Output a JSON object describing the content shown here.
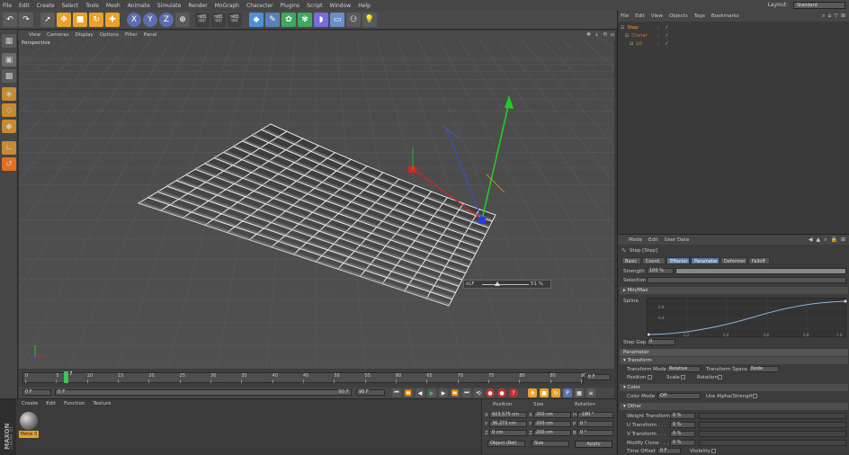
{
  "menu": [
    "File",
    "Edit",
    "Create",
    "Select",
    "Tools",
    "Mesh",
    "Animate",
    "Simulate",
    "Render",
    "MoGraph",
    "Character",
    "Plugins",
    "Script",
    "Window",
    "Help"
  ],
  "layout": {
    "label": "Layout:",
    "value": "Standard"
  },
  "toolbar": {
    "x": "X",
    "y": "Y",
    "z": "Z"
  },
  "viewport": {
    "menu": [
      "View",
      "Cameras",
      "Display",
      "Options",
      "Filter",
      "Panel"
    ],
    "label": "Perspective",
    "lod_label": "oLF",
    "lod_value": "51 %"
  },
  "timeline": {
    "ticks": [
      "0",
      "5",
      "10",
      "15",
      "20",
      "25",
      "30",
      "35",
      "40",
      "45",
      "50",
      "55",
      "60",
      "65",
      "70",
      "75",
      "80",
      "85",
      "90"
    ],
    "current_frame": "7",
    "end_field": "0 F",
    "start": "0 F",
    "start2": "0 F",
    "end": "90 F",
    "end2": "90 F"
  },
  "material": {
    "menu": [
      "Create",
      "Edit",
      "Function",
      "Texture"
    ],
    "item": "Metal 0",
    "brand1": "MAXON",
    "brand2": "CINEMA 4D"
  },
  "coords": {
    "headers": [
      "Position",
      "Size",
      "Rotation"
    ],
    "rows": [
      {
        "axis": "X",
        "pos": "923.575 cm",
        "size": "200 cm",
        "rlabel": "H",
        "rot": "-180 °"
      },
      {
        "axis": "Y",
        "pos": "36.272 cm",
        "size": "200 cm",
        "rlabel": "P",
        "rot": "0 °"
      },
      {
        "axis": "Z",
        "pos": "0 cm",
        "size": "200 cm",
        "rlabel": "B",
        "rot": "0 °"
      }
    ],
    "mode": "Object (Rel)",
    "size_mode": "Size",
    "apply": "Apply"
  },
  "objects": {
    "menu": [
      "File",
      "Edit",
      "View",
      "Objects",
      "Tags",
      "Bookmarks"
    ],
    "items": [
      {
        "name": "Step",
        "color": "#e8a030"
      },
      {
        "name": "Cloner",
        "color": "#e07020"
      },
      {
        "name": "L0",
        "color": "#c89030"
      }
    ]
  },
  "attributes": {
    "menu": [
      "Mode",
      "Edit",
      "User Data"
    ],
    "title": "Step [Step]",
    "tabs": [
      "Basic",
      "Coord.",
      "Effector",
      "Parameter",
      "Deformer",
      "Falloff"
    ],
    "strength_label": "Strength",
    "strength_value": "100 %",
    "selection_label": "Selection",
    "minmax": "Min/Max",
    "spline_label": "Spline",
    "spline_y": [
      "0.8",
      "0.4"
    ],
    "spline_x": [
      "0.2",
      "0.4",
      "0.6",
      "0.8",
      "1.0"
    ],
    "step_gap_label": "Step Gap",
    "step_gap_value": "0",
    "parameter_section": "Parameter",
    "transform_section": "Transform",
    "transform_mode_label": "Transform Mode",
    "transform_mode_value": "Relative",
    "transform_space_label": "Transform Space",
    "transform_space_value": "Node",
    "position_label": "Position",
    "scale_label": "Scale",
    "rotation_label": "Rotation",
    "color_section": "Color",
    "color_mode_label": "Color Mode",
    "color_mode_value": "Off",
    "use_alpha_label": "Use Alpha/Strength",
    "other_section": "Other",
    "others": [
      {
        "label": "Weight Transform",
        "value": "0 %"
      },
      {
        "label": "U Transform . . .",
        "value": "0 %"
      },
      {
        "label": "V Transform . . .",
        "value": "0 %"
      },
      {
        "label": "Modify Clone . . .",
        "value": "0 %"
      }
    ],
    "time_offset_label": "Time Offset",
    "time_offset_value": "0 F",
    "visibility_label": "Visibility"
  }
}
